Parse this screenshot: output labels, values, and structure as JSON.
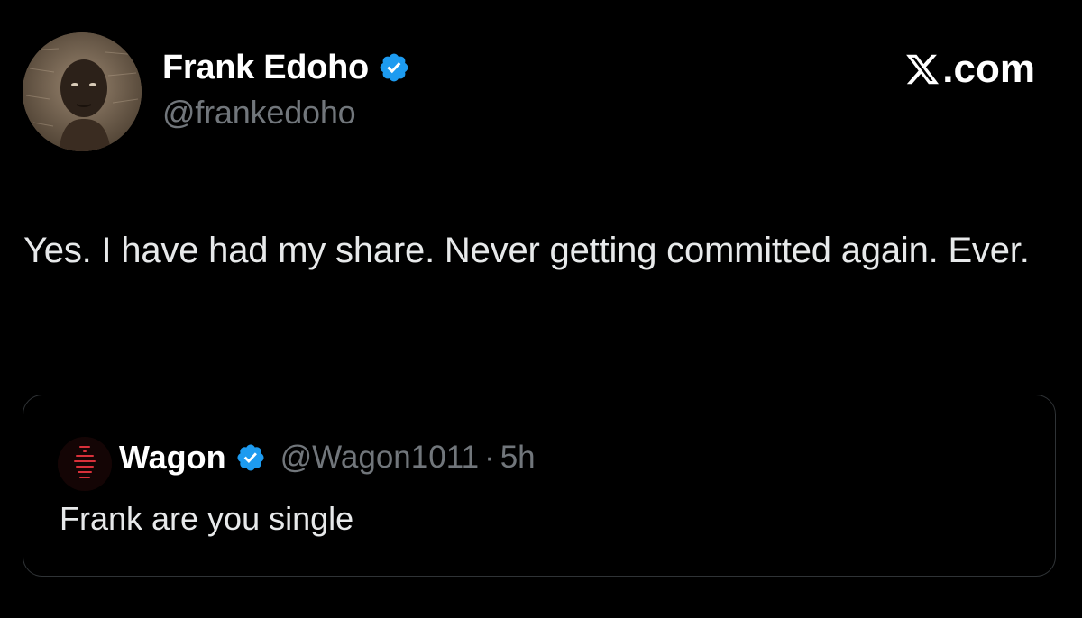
{
  "tweet": {
    "author": {
      "display_name": "Frank Edoho",
      "handle": "@frankedoho",
      "verified": true,
      "avatar_icon": "profile-photo"
    },
    "site_label": ".com",
    "site_icon": "x-logo-icon",
    "text": "Yes. I have had my share. Never getting committed again. Ever."
  },
  "quoted": {
    "display_name": "Wagon",
    "handle": "@Wagon1011",
    "separator": "·",
    "time": "5h",
    "verified": true,
    "avatar_icon": "neon-sign-avatar",
    "text": "Frank are you single"
  },
  "colors": {
    "background": "#000000",
    "primary_text": "#e7e9ea",
    "secondary_text": "#71767b",
    "verified_badge": "#1d9bf0",
    "quote_border": "#2f3336"
  }
}
